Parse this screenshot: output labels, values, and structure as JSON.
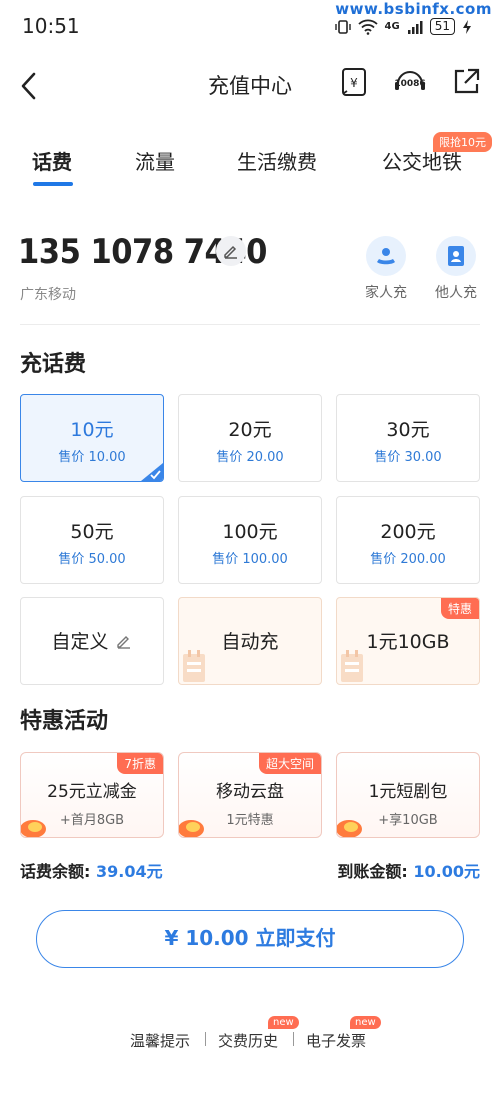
{
  "status_bar": {
    "time": "10:51",
    "watermark": "www.bsbinfx.com",
    "network": "4G",
    "battery": "51"
  },
  "nav": {
    "title": "充值中心",
    "service_number": "10086"
  },
  "tabs": [
    {
      "label": "话费",
      "active": true
    },
    {
      "label": "流量",
      "active": false
    },
    {
      "label": "生活缴费",
      "active": false
    },
    {
      "label": "公交地铁",
      "active": false,
      "badge": "限抢10元"
    }
  ],
  "account": {
    "phone": "135 1078 7440",
    "carrier": "广东移动",
    "quick_actions": [
      {
        "label": "家人充",
        "icon": "family-recharge-icon"
      },
      {
        "label": "他人充",
        "icon": "contact-book-icon"
      }
    ]
  },
  "recharge": {
    "title": "充话费",
    "options": [
      {
        "amount": "10元",
        "price": "售价 10.00",
        "selected": true
      },
      {
        "amount": "20元",
        "price": "售价 20.00",
        "selected": false
      },
      {
        "amount": "30元",
        "price": "售价 30.00",
        "selected": false
      },
      {
        "amount": "50元",
        "price": "售价 50.00",
        "selected": false
      },
      {
        "amount": "100元",
        "price": "售价 100.00",
        "selected": false
      },
      {
        "amount": "200元",
        "price": "售价 200.00",
        "selected": false
      }
    ],
    "custom_label": "自定义",
    "auto_label": "自动充",
    "package_label": "1元10GB",
    "package_tag": "特惠"
  },
  "promotions": {
    "title": "特惠活动",
    "items": [
      {
        "title": "25元立减金",
        "sub": "+首月8GB",
        "tag": "7折惠"
      },
      {
        "title": "移动云盘",
        "sub": "1元特惠",
        "tag": "超大空间"
      },
      {
        "title": "1元短剧包",
        "sub": "+享10GB",
        "tag": ""
      }
    ]
  },
  "balance": {
    "left_label": "话费余额: ",
    "left_value": "39.04元",
    "right_label": "到账金额: ",
    "right_value": "10.00元"
  },
  "pay": {
    "label": "¥ 10.00  立即支付"
  },
  "footer": {
    "links": [
      {
        "label": "温馨提示",
        "badge": ""
      },
      {
        "label": "交费历史",
        "badge": "new"
      },
      {
        "label": "电子发票",
        "badge": "new"
      }
    ]
  },
  "colors": {
    "accent": "#2d7be0",
    "selected_bg": "#eef5fe",
    "tag_red": "#ff6d52"
  }
}
